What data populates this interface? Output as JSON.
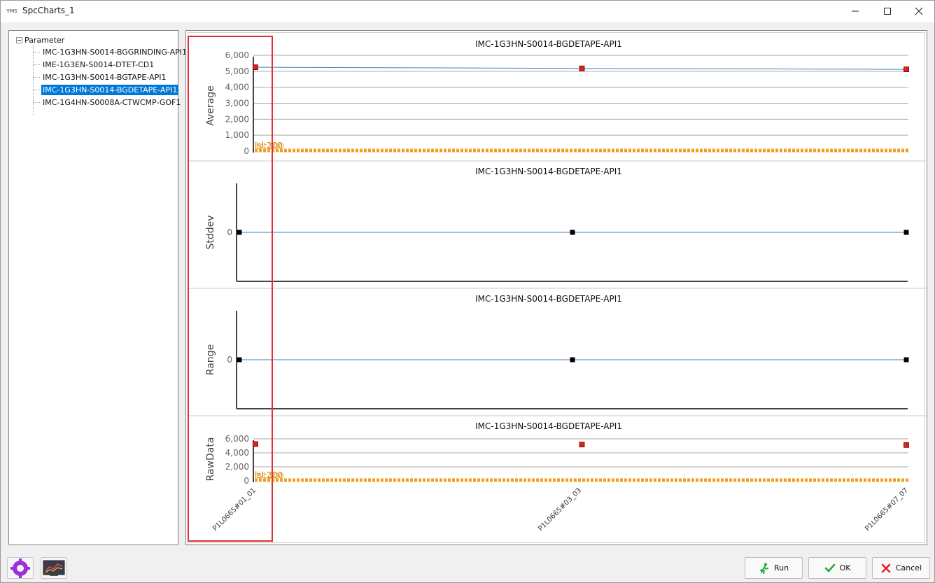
{
  "window": {
    "app_icon": "YMS",
    "title": "SpcCharts_1",
    "controls": [
      "minimize-icon",
      "maximize-icon",
      "close-icon"
    ]
  },
  "tree": {
    "root_label": "Parameter",
    "items": [
      {
        "label": "IMC-1G3HN-S0014-BGGRINDING-API1",
        "selected": false
      },
      {
        "label": "IME-1G3EN-S0014-DTET-CD1",
        "selected": false
      },
      {
        "label": "IMC-1G3HN-S0014-BGTAPE-API1",
        "selected": false
      },
      {
        "label": "IMC-1G3HN-S0014-BGDETAPE-API1",
        "selected": true
      },
      {
        "label": "IMC-1G4HN-S0008A-CTWCMP-GOF1",
        "selected": false
      }
    ]
  },
  "chart_data": [
    {
      "type": "line",
      "title": "IMC-1G3HN-S0014-BGDETAPE-API1",
      "ylabel": "Average",
      "xlabel": "",
      "ylim": [
        0,
        6000
      ],
      "yticks": [
        "6,000",
        "5,000",
        "4,000",
        "3,000",
        "2,000",
        "1,000",
        "0"
      ],
      "categories": [
        "P1L0665#01_01",
        "P1L0665#03_03",
        "P1L0665#07_07"
      ],
      "values": [
        5250,
        5180,
        5120
      ],
      "grid": true,
      "overlap_label": "lsl:200",
      "marker_color": "#e02020"
    },
    {
      "type": "line",
      "title": "IMC-1G3HN-S0014-BGDETAPE-API1",
      "ylabel": "Stddev",
      "xlabel": "",
      "yticks": [
        "0"
      ],
      "categories": [
        "P1L0665#01_01",
        "P1L0665#03_03",
        "P1L0665#07_07"
      ],
      "values": [
        0,
        0,
        0
      ],
      "grid": false,
      "marker_color": "#000000"
    },
    {
      "type": "line",
      "title": "IMC-1G3HN-S0014-BGDETAPE-API1",
      "ylabel": "Range",
      "xlabel": "",
      "yticks": [
        "0"
      ],
      "categories": [
        "P1L0665#01_01",
        "P1L0665#03_03",
        "P1L0665#07_07"
      ],
      "values": [
        0,
        0,
        0
      ],
      "grid": false,
      "marker_color": "#000000"
    },
    {
      "type": "scatter",
      "title": "IMC-1G3HN-S0014-BGDETAPE-API1",
      "ylabel": "RawData",
      "xlabel": "",
      "ylim": [
        0,
        6000
      ],
      "yticks": [
        "6,000",
        "4,000",
        "2,000",
        "0"
      ],
      "categories": [
        "P1L0665#01_01",
        "P1L0665#03_03",
        "P1L0665#07_07"
      ],
      "values": [
        5250,
        5180,
        5120
      ],
      "grid": true,
      "overlap_label": "lsl:200",
      "marker_color": "#e02020"
    }
  ],
  "footer": {
    "settings_icon": "gear-icon",
    "chart_icon": "chart-icon",
    "run_label": "Run",
    "ok_label": "OK",
    "cancel_label": "Cancel"
  }
}
